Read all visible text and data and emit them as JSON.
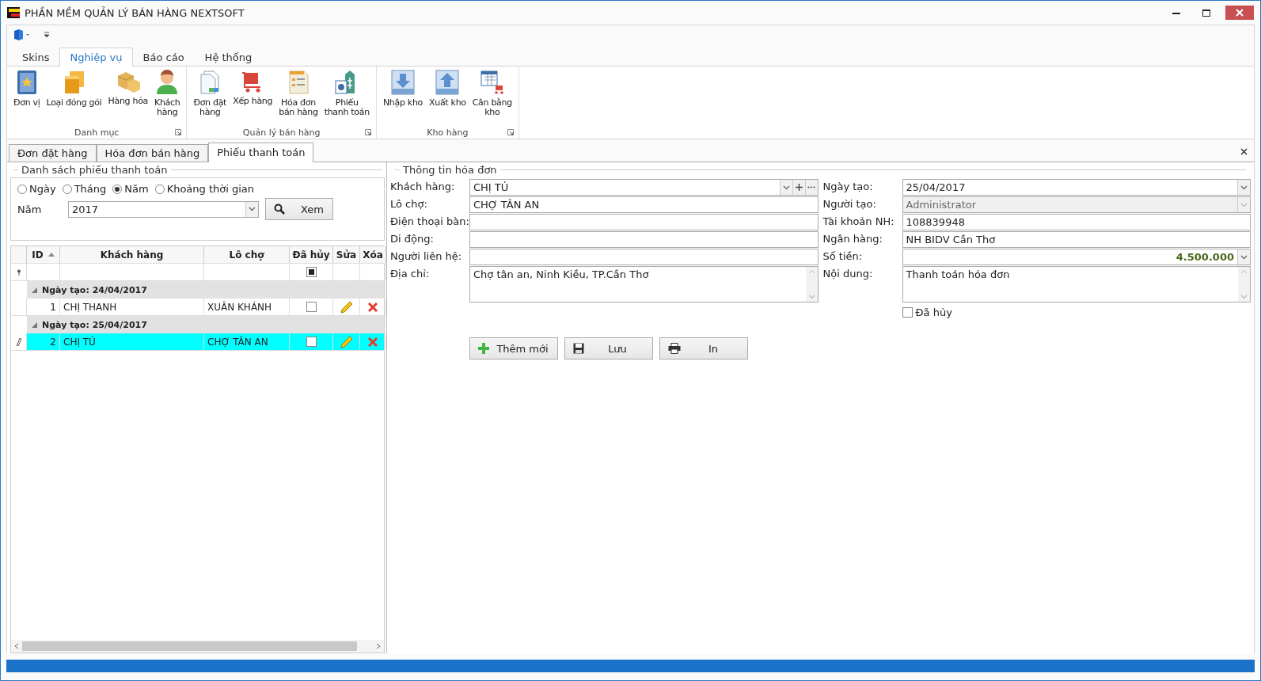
{
  "window": {
    "title": "PHẦN MỀM QUẢN LÝ BÁN HÀNG NEXTSOFT"
  },
  "ribbon": {
    "tabs": [
      {
        "label": "Skins",
        "selected": false
      },
      {
        "label": "Nghiệp vụ",
        "selected": true
      },
      {
        "label": "Báo cáo",
        "selected": false
      },
      {
        "label": "Hệ thống",
        "selected": false
      }
    ],
    "groups": [
      {
        "label": "Danh mục",
        "buttons": [
          {
            "label": "Đơn vị"
          },
          {
            "label": "Loại đóng gói"
          },
          {
            "label": "Hàng hóa"
          },
          {
            "label": "Khách\nhàng"
          }
        ]
      },
      {
        "label": "Quản lý bán hàng",
        "buttons": [
          {
            "label": "Đơn đặt\nhàng"
          },
          {
            "label": "Xếp hàng"
          },
          {
            "label": "Hóa đơn\nbán hàng"
          },
          {
            "label": "Phiếu\nthanh toán"
          }
        ]
      },
      {
        "label": "Kho hàng",
        "buttons": [
          {
            "label": "Nhập kho"
          },
          {
            "label": "Xuất kho"
          },
          {
            "label": "Cân bằng\nkho"
          }
        ]
      }
    ]
  },
  "doc_tabs": [
    {
      "label": "Đơn đặt hàng",
      "selected": false
    },
    {
      "label": "Hóa đơn bán hàng",
      "selected": false
    },
    {
      "label": "Phiếu thanh toán",
      "selected": true
    }
  ],
  "left_panel": {
    "title": "Danh sách phiếu thanh toán",
    "radios": [
      {
        "label": "Ngày",
        "selected": false
      },
      {
        "label": "Tháng",
        "selected": false
      },
      {
        "label": "Năm",
        "selected": true
      },
      {
        "label": "Khoảng thời gian",
        "selected": false
      }
    ],
    "year_label": "Năm",
    "year_value": "2017",
    "view_button": "Xem",
    "grid": {
      "columns": [
        {
          "label": "ID",
          "sorted": true
        },
        {
          "label": "Khách hàng",
          "sorted": false
        },
        {
          "label": "Lô chợ",
          "sorted": false
        },
        {
          "label": "Đã hủy",
          "sorted": false
        },
        {
          "label": "Sửa",
          "sorted": false
        },
        {
          "label": "Xóa",
          "sorted": false
        }
      ],
      "filter_checked": true,
      "groups": [
        {
          "label": "Ngày tạo: 24/04/2017",
          "expanded": true,
          "rows": [
            {
              "id": "1",
              "customer": "CHỊ THANH",
              "market": "XUÂN KHÁNH",
              "cancelled": false,
              "selected": false
            }
          ]
        },
        {
          "label": "Ngày tạo: 25/04/2017",
          "expanded": true,
          "rows": [
            {
              "id": "2",
              "customer": "CHỊ TÚ",
              "market": "CHỢ TÂN AN",
              "cancelled": false,
              "selected": true
            }
          ]
        }
      ]
    }
  },
  "right_panel": {
    "title": "Thông tin hóa đơn",
    "left_fields": [
      {
        "label": "Khách hàng:",
        "value": "CHỊ TÚ",
        "kind": "lookup",
        "disabled": false
      },
      {
        "label": "Lô chợ:",
        "value": "CHỢ TÂN AN",
        "kind": "text",
        "disabled": false
      },
      {
        "label": "Điện thoại bàn:",
        "kind": "text",
        "disabled": false
      },
      {
        "label": "Di động:",
        "kind": "text",
        "disabled": false
      },
      {
        "label": "Người liên hệ:",
        "kind": "text",
        "disabled": false
      },
      {
        "label": "Địa chỉ:",
        "value": "Chợ tân an, Ninh Kiều, TP.Cần Thơ",
        "kind": "memo",
        "disabled": false
      }
    ],
    "right_fields": [
      {
        "label": "Ngày tạo:",
        "value": "25/04/2017",
        "kind": "combo",
        "disabled": false
      },
      {
        "label": "Người tạo:",
        "value": "Administrator",
        "kind": "combo",
        "disabled": true
      },
      {
        "label": "Tài khoản NH:",
        "value": "108839948",
        "kind": "text",
        "disabled": false
      },
      {
        "label": "Ngân hàng:",
        "value": "NH BIDV Cần Thơ",
        "kind": "text",
        "disabled": false
      },
      {
        "label": "Số tiền:",
        "value": "4.500.000",
        "kind": "amount",
        "disabled": false
      },
      {
        "label": "Nội dung:",
        "value": "Thanh toán hóa đơn",
        "kind": "memo",
        "disabled": false
      }
    ],
    "cancelled": {
      "label": "Đã hủy",
      "checked": false
    },
    "buttons": [
      {
        "label": "Thêm mới",
        "kind": "add"
      },
      {
        "label": "Lưu",
        "kind": "save"
      },
      {
        "label": "In",
        "kind": "print"
      }
    ]
  }
}
